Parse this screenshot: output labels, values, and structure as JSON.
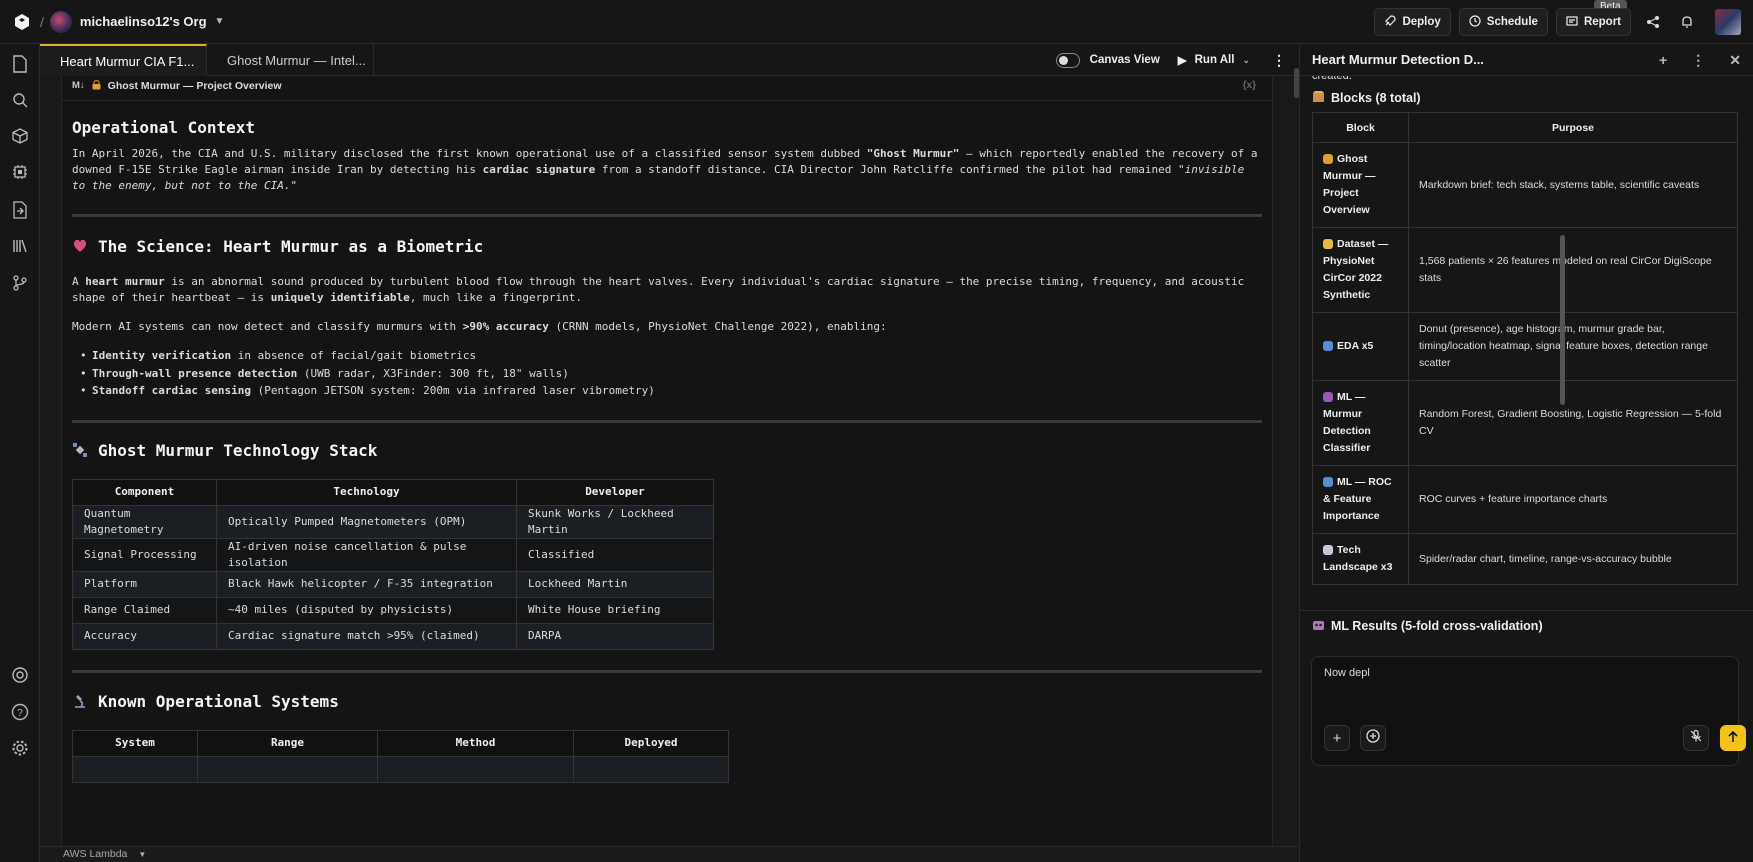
{
  "topbar": {
    "org": "michaelinso12's Org",
    "deploy": "Deploy",
    "schedule": "Schedule",
    "report": "Report",
    "beta": "Beta"
  },
  "tabs": [
    {
      "label": "Heart Murmur CIA F1..."
    },
    {
      "label": "Ghost Murmur — Intel..."
    }
  ],
  "toolbar": {
    "canvas_view": "Canvas View",
    "run_all": "Run All"
  },
  "cell": {
    "md_badge": "M↓",
    "title": "Ghost Murmur — Project Overview",
    "xbadge": "{x}"
  },
  "doc": {
    "h_context": "Operational Context",
    "p_context": [
      "In April 2026, the CIA and U.S. military disclosed the first known operational use of a classified sensor system dubbed ",
      "\"Ghost Murmur\"",
      " — which reportedly enabled the recovery of a downed F-15E Strike Eagle airman inside Iran by detecting his ",
      "cardiac signature",
      " from a standoff distance. CIA Director John Ratcliffe confirmed the pilot had remained \"",
      "invisible to the enemy, but not to the CIA.",
      "\""
    ],
    "h_science": "The Science: Heart Murmur as a Biometric",
    "p_science": [
      "A ",
      "heart murmur",
      " is an abnormal sound produced by turbulent blood flow through the heart valves. Every individual's cardiac signature — the precise timing, frequency, and acoustic shape of their heartbeat — is ",
      "uniquely identifiable",
      ", much like a fingerprint."
    ],
    "p_modern": [
      "Modern AI systems can now detect and classify murmurs with ",
      ">90% accuracy",
      " (CRNN models, PhysioNet Challenge 2022), enabling:"
    ],
    "bullets": [
      {
        "b": "Identity verification",
        "t": " in absence of facial/gait biometrics"
      },
      {
        "b": "Through-wall presence detection",
        "t": " (UWB radar, X3Finder: 300 ft, 18\" walls)"
      },
      {
        "b": "Standoff cardiac sensing",
        "t": " (Pentagon JETSON system: 200m via infrared laser vibrometry)"
      }
    ],
    "h_stack": "Ghost Murmur Technology Stack",
    "stack_headers": [
      "Component",
      "Technology",
      "Developer"
    ],
    "stack_rows": [
      [
        "Quantum Magnetometry",
        "Optically Pumped Magnetometers (OPM)",
        "Skunk Works / Lockheed Martin"
      ],
      [
        "Signal Processing",
        "AI-driven noise cancellation & pulse isolation",
        "Classified"
      ],
      [
        "Platform",
        "Black Hawk helicopter / F-35 integration",
        "Lockheed Martin"
      ],
      [
        "Range Claimed",
        "~40 miles (disputed by physicists)",
        "White House briefing"
      ],
      [
        "Accuracy",
        "Cardiac signature match >95% (claimed)",
        "DARPA"
      ]
    ],
    "h_systems": "Known Operational Systems",
    "systems_headers": [
      "System",
      "Range",
      "Method",
      "Deployed"
    ]
  },
  "panel": {
    "title": "Heart Murmur Detection D...",
    "cut_text": "created.",
    "blocks_title": "Blocks (8 total)",
    "blocks_headers": [
      "Block",
      "Purpose"
    ],
    "blocks": [
      {
        "block": "Ghost Murmur — Project Overview",
        "purpose": "Markdown brief: tech stack, systems table, scientific caveats",
        "emoji": "#e0a030"
      },
      {
        "block": "Dataset — PhysioNet CirCor 2022 Synthetic",
        "purpose": "1,568 patients × 26 features modeled on real CirCor DigiScope stats",
        "emoji": "#e8b840"
      },
      {
        "block": "EDA x5",
        "purpose": "Donut (presence), age histogram, murmur grade bar, timing/location heatmap, signal feature boxes, detection range scatter",
        "emoji": "#5a8fd8"
      },
      {
        "block": "ML — Murmur Detection Classifier",
        "purpose": "Random Forest, Gradient Boosting, Logistic Regression — 5-fold CV",
        "emoji": "#9a5ab8"
      },
      {
        "block": "ML — ROC & Feature Importance",
        "purpose": "ROC curves + feature importance charts",
        "emoji": "#5a8fd8"
      },
      {
        "block": "Tech Landscape x3",
        "purpose": "Spider/radar chart, timeline, range-vs-accuracy bubble",
        "emoji": "#c8c8d8"
      }
    ],
    "ml_title": "ML Results (5-fold cross-validation)",
    "chat_text": "Now depl"
  },
  "status": {
    "env": "AWS Lambda"
  }
}
